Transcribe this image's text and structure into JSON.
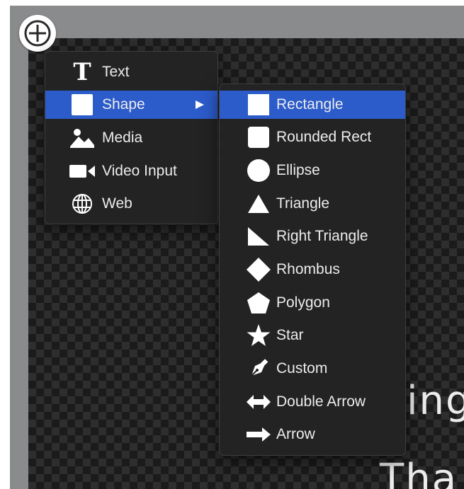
{
  "background_text": {
    "line1": "ing",
    "line2": "Tha"
  },
  "add_button": {
    "icon": "plus-icon"
  },
  "primary_menu": {
    "items": [
      {
        "label": "Text",
        "icon": "text-icon"
      },
      {
        "label": "Shape",
        "icon": "square-icon",
        "selected": true,
        "has_submenu": true
      },
      {
        "label": "Media",
        "icon": "image-icon"
      },
      {
        "label": "Video Input",
        "icon": "video-camera-icon"
      },
      {
        "label": "Web",
        "icon": "globe-icon"
      }
    ]
  },
  "shape_menu": {
    "items": [
      {
        "label": "Rectangle",
        "icon": "rectangle-icon",
        "selected": true
      },
      {
        "label": "Rounded Rect",
        "icon": "rounded-rect-icon"
      },
      {
        "label": "Ellipse",
        "icon": "ellipse-icon"
      },
      {
        "label": "Triangle",
        "icon": "triangle-icon"
      },
      {
        "label": "Right Triangle",
        "icon": "right-triangle-icon"
      },
      {
        "label": "Rhombus",
        "icon": "rhombus-icon"
      },
      {
        "label": "Polygon",
        "icon": "polygon-icon"
      },
      {
        "label": "Star",
        "icon": "star-icon"
      },
      {
        "label": "Custom",
        "icon": "pen-icon"
      },
      {
        "label": "Double Arrow",
        "icon": "double-arrow-icon"
      },
      {
        "label": "Arrow",
        "icon": "arrow-icon"
      }
    ]
  },
  "colors": {
    "menu_bg": "#232324",
    "highlight": "#2c5bca",
    "text": "#ececec"
  }
}
